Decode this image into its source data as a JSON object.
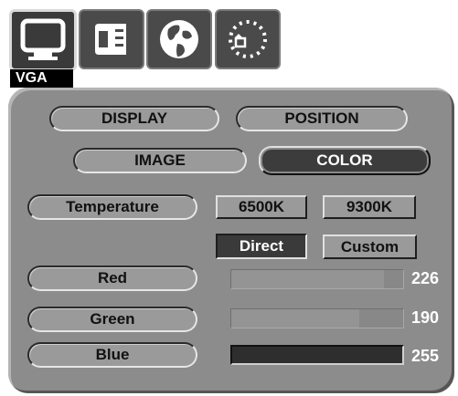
{
  "source_tag": "VGA",
  "top_icons": [
    "monitor-icon",
    "layout-icon",
    "globe-icon",
    "dotted-circle-icon"
  ],
  "tabs": {
    "display": "DISPLAY",
    "position": "POSITION",
    "image": "IMAGE",
    "color": "COLOR"
  },
  "temperature": {
    "label": "Temperature",
    "options": [
      "6500K",
      "9300K"
    ],
    "modes": [
      "Direct",
      "Custom"
    ],
    "selected_mode": "Direct"
  },
  "channels": [
    {
      "label": "Red",
      "value": "226",
      "fraction": 0.886
    },
    {
      "label": "Green",
      "value": "190",
      "fraction": 0.745
    },
    {
      "label": "Blue",
      "value": "255",
      "fraction": 1.0
    }
  ]
}
